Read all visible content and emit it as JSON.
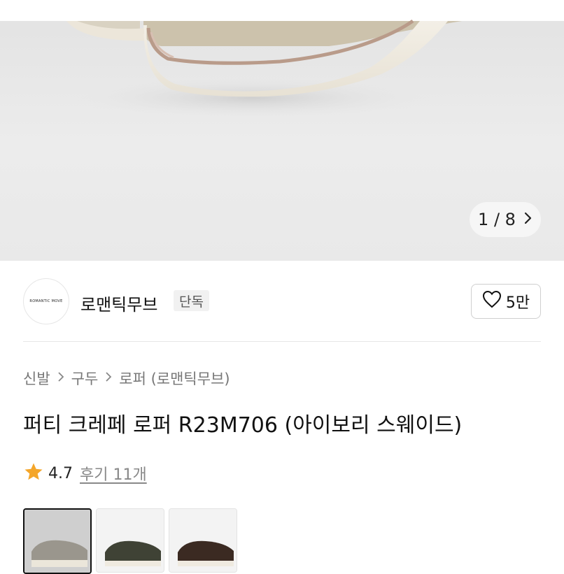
{
  "gallery": {
    "counter": "1 / 8",
    "next_icon": "chevron-right-icon"
  },
  "brand": {
    "logo_text": "ROMANTIC MOVE",
    "name": "로맨틱무브",
    "exclusive_badge": "단독",
    "like_count": "5만",
    "like_icon": "heart-outline-icon"
  },
  "breadcrumb": {
    "items": [
      "신발",
      "구두",
      "로퍼 (로맨틱무브)"
    ]
  },
  "product": {
    "title": "퍼티 크레페 로퍼 R23M706 (아이보리 스웨이드)"
  },
  "rating": {
    "score": "4.7",
    "reviews": "후기 11개",
    "star_color": "#F4A62A"
  },
  "colors": {
    "thumb_1": "#9a968d",
    "thumb_2": "#3f4235",
    "thumb_3": "#3b2a22"
  }
}
